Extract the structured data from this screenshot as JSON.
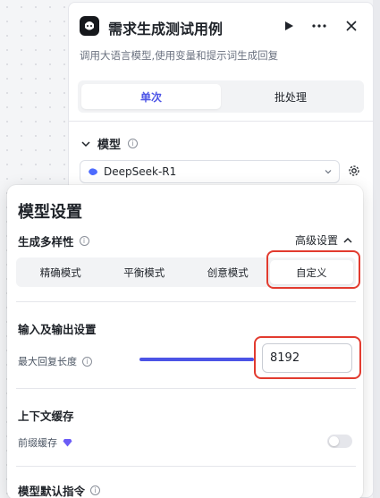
{
  "panel": {
    "title": "需求生成测试用例",
    "description": "调用大语言模型,使用变量和提示词生成回复"
  },
  "mode_tabs": [
    {
      "label": "单次",
      "active": true
    },
    {
      "label": "批处理",
      "active": false
    }
  ],
  "model_section": {
    "label": "模型",
    "selected_model": "DeepSeek-R1"
  },
  "model_settings": {
    "title": "模型设置",
    "diversity": {
      "label": "生成多样性",
      "advanced_label": "高级设置",
      "options": [
        "精确模式",
        "平衡模式",
        "创意模式",
        "自定义"
      ],
      "selected": "自定义"
    },
    "io_settings": {
      "label": "输入及输出设置",
      "max_reply_label": "最大回复长度",
      "max_reply_value": "8192"
    },
    "context_cache": {
      "label": "上下文缓存",
      "prefix_cache_label": "前缀缓存",
      "enabled": false
    },
    "default_prompt_label": "模型默认指令"
  },
  "colors": {
    "accent": "#4c54e6",
    "highlight_box": "#e23b2f"
  }
}
